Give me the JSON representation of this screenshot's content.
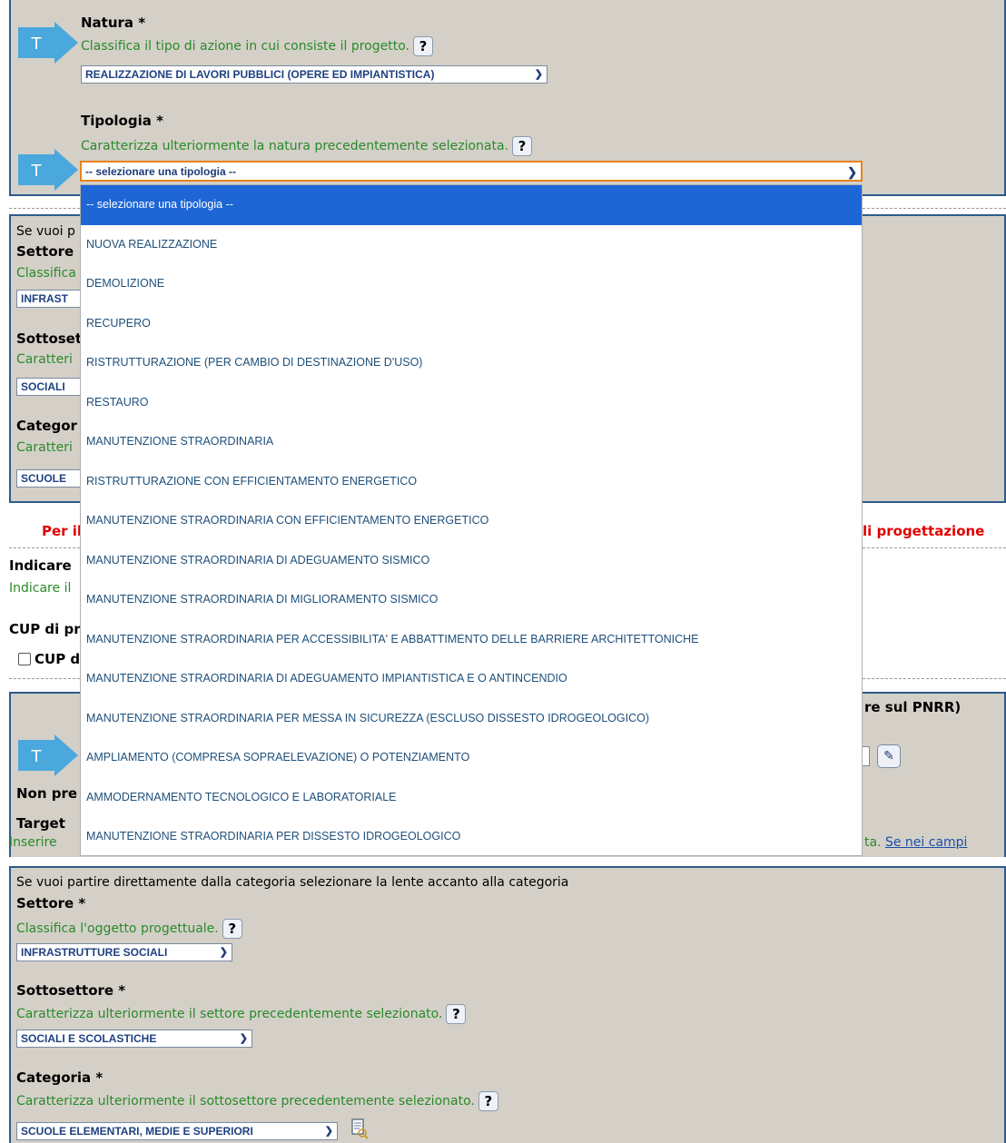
{
  "natura": {
    "label": "Natura *",
    "description": "Classifica il tipo di azione in cui consiste il progetto.",
    "selected": "REALIZZAZIONE DI LAVORI PUBBLICI (OPERE ED IMPIANTISTICA)"
  },
  "tipologia": {
    "label": "Tipologia *",
    "description": "Caratterizza ulteriormente la natura precedentemente selezionata.",
    "selected": "-- selezionare una tipologia --",
    "options": [
      "-- selezionare una tipologia --",
      "NUOVA REALIZZAZIONE",
      "DEMOLIZIONE",
      "RECUPERO",
      "RISTRUTTURAZIONE (PER CAMBIO DI DESTINAZIONE D'USO)",
      "RESTAURO",
      "MANUTENZIONE STRAORDINARIA",
      "RISTRUTTURAZIONE CON EFFICIENTAMENTO ENERGETICO",
      "MANUTENZIONE STRAORDINARIA CON EFFICIENTAMENTO ENERGETICO",
      "MANUTENZIONE STRAORDINARIA DI ADEGUAMENTO SISMICO",
      "MANUTENZIONE STRAORDINARIA DI MIGLIORAMENTO SISMICO",
      "MANUTENZIONE STRAORDINARIA PER ACCESSIBILITA' E ABBATTIMENTO DELLE BARRIERE ARCHITETTONICHE",
      "MANUTENZIONE STRAORDINARIA DI ADEGUAMENTO IMPIANTISTICA E O ANTINCENDIO",
      "MANUTENZIONE STRAORDINARIA PER MESSA IN SICUREZZA (ESCLUSO DISSESTO IDROGEOLOGICO)",
      "AMPLIAMENTO (COMPRESA SOPRAELEVAZIONE) O POTENZIAMENTO",
      "AMMODERNAMENTO TECNOLOGICO E LABORATORIALE",
      "MANUTENZIONE STRAORDINARIA PER DISSESTO IDROGEOLOGICO"
    ]
  },
  "help_glyph": "?",
  "t_badge": "T",
  "background_partial": {
    "intro": "Se vuoi p",
    "settore": "Settore",
    "classifica": "Classifica",
    "infra": "INFRAST",
    "sottosettore": "Sottoset",
    "caratteri1": "Caratteri",
    "sociali": "SOCIALI",
    "categoria": "Categor",
    "caratteri2": "Caratteri",
    "scuole": "SCUOLE",
    "per_il": "Per il C",
    "progettazione": "li progettazione",
    "indicare_bold": "Indicare",
    "indicare_green": "Indicare il",
    "cup_di": "CUP di pr",
    "cup_chk": "CUP d",
    "pnrr": "re sul PNRR)",
    "non_pre": "Non pre",
    "target": "Target",
    "inserire": "Inserire",
    "target_tail": "ta.",
    "target_link": "Se nei campi"
  },
  "bottom": {
    "intro": "Se vuoi partire direttamente dalla categoria selezionare la lente accanto alla categoria",
    "settore_label": "Settore *",
    "settore_desc": "Classifica l'oggetto progettuale.",
    "settore_value": "INFRASTRUTTURE SOCIALI",
    "sottosettore_label": "Sottosettore *",
    "sottosettore_desc": "Caratterizza ulteriormente il settore precedentemente selezionato.",
    "sottosettore_value": "SOCIALI E SCOLASTICHE",
    "categoria_label": "Categoria *",
    "categoria_desc": "Caratterizza ulteriormente il sottosettore precedentemente selezionato.",
    "categoria_value": "SCUOLE ELEMENTARI, MEDIE E SUPERIORI"
  },
  "colors": {
    "panel_bg": "#d4d0c8",
    "panel_border": "#2e5a8a",
    "description_green": "#2a8a2a",
    "highlight_blue": "#1e66d6",
    "arrow_blue": "#4aa8dc",
    "focus_orange": "#e8821e",
    "warning_red": "#e00000"
  }
}
